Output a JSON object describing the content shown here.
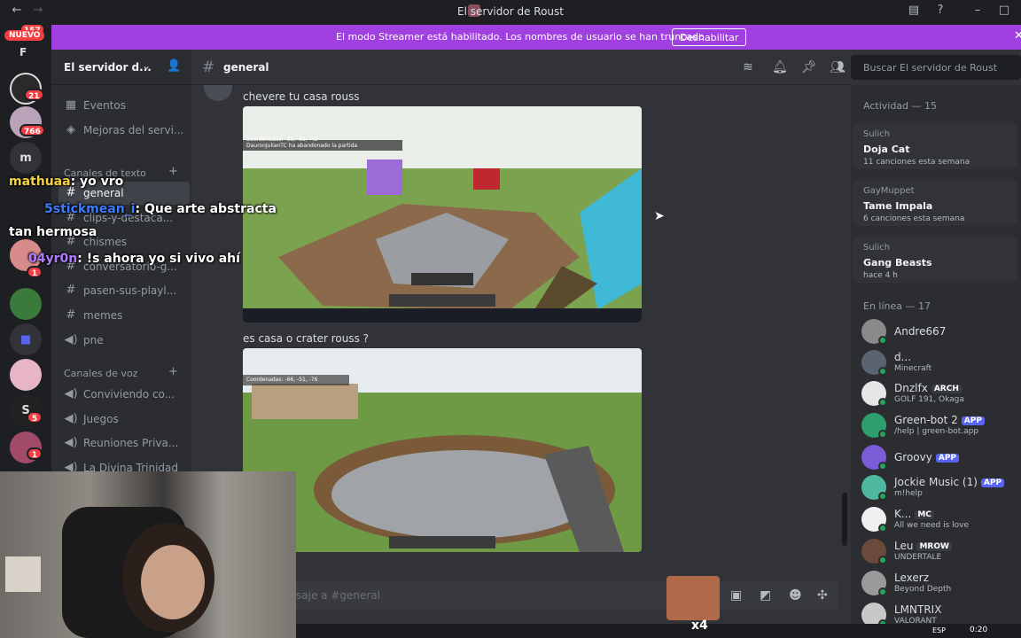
{
  "window": {
    "title": "El servidor de Roust"
  },
  "banner": {
    "message": "El modo Streamer está habilitado. Los nombres de usuario se han truncado.",
    "button": "Deshabilitar"
  },
  "rail": {
    "top_badge": "157",
    "nuevo": "NUEVO",
    "letter_f": "F",
    "badge_21": "21",
    "badge_766": "766",
    "letter_m": "m",
    "badge_1a": "1",
    "badge_1b": "1",
    "badge_5": "5",
    "letter_s": "S"
  },
  "sidebar": {
    "server_name": "El servidor d...",
    "items": [
      {
        "label": "Eventos"
      },
      {
        "label": "Mejoras del servi..."
      }
    ],
    "text_category": "Canales de texto",
    "text_channels": [
      {
        "label": "general"
      },
      {
        "label": "clips-y-destaca..."
      },
      {
        "label": "chismes"
      },
      {
        "label": "conversatorio-g..."
      },
      {
        "label": "pasen-sus-playl..."
      },
      {
        "label": "memes"
      },
      {
        "label": "pne"
      }
    ],
    "voice_category": "Canales de voz",
    "voice_channels": [
      {
        "label": "Conviviendo co..."
      },
      {
        "label": "Juegos"
      },
      {
        "label": "Reuniones Priva..."
      },
      {
        "label": "La Divina Trinidad"
      }
    ]
  },
  "chat_header": {
    "channel": "general",
    "search_placeholder": "Buscar El servidor de Roust"
  },
  "messages": [
    {
      "text": "chevere tu casa rouss",
      "image_hud": "Coordenadas: -86, -55, -42",
      "image_hud2": "DauronJulianTC ha abandonado la partida"
    },
    {
      "text": "es casa o crater rouss ?",
      "image_hud": "Coordenadas: -66, -51, -76"
    }
  ],
  "input": {
    "placeholder": "saje a #general"
  },
  "members": {
    "activity_header": "Actividad — 15",
    "activities": [
      {
        "user": "Sulich",
        "title": "Doja Cat",
        "sub": "11 canciones esta semana"
      },
      {
        "user": "GayMuppet",
        "title": "Tame Impala",
        "sub": "6 canciones esta semana"
      },
      {
        "user": "Sulich",
        "title": "Gang Beasts",
        "sub": "hace 4 h"
      }
    ],
    "online_header": "En línea — 17",
    "online": [
      {
        "name": "Andre667",
        "sub": "",
        "tag": ""
      },
      {
        "name": "d...",
        "sub": "Minecraft",
        "tag": ""
      },
      {
        "name": "Dnzlfx",
        "sub": "GOLF 191, Okaga",
        "tag": "ARCH"
      },
      {
        "name": "Green-bot 2",
        "sub": "/help | green-bot.app",
        "tag": "APP"
      },
      {
        "name": "Groovy",
        "sub": "",
        "tag": "APP"
      },
      {
        "name": "Jockie Music (1)",
        "sub": "m!help",
        "tag": "APP"
      },
      {
        "name": "K...",
        "sub": "All we need is love",
        "tag": "MC"
      },
      {
        "name": "Leu",
        "sub": "UNDERTALE",
        "tag": "MROW"
      },
      {
        "name": "Lexerz",
        "sub": "Beyond Depth",
        "tag": ""
      },
      {
        "name": "LMNTRIX",
        "sub": "VALORANT",
        "tag": ""
      }
    ]
  },
  "overlay_chat": [
    {
      "user": "mathuaa",
      "text": ": yo vro"
    },
    {
      "user": "5stickmean_i",
      "text": ": Que arte abstracta"
    },
    {
      "user": "",
      "text": "tan hermosa"
    },
    {
      "user": "04yr0n",
      "text": ": !s ahora yo si vivo ahí"
    }
  ],
  "taskbar": {
    "lang": "ESP",
    "time": "0:20",
    "x4": "x4"
  },
  "colors": {
    "banner": "#a040e0",
    "accent": "#5865f2",
    "online": "#23a55a",
    "badge": "#f23f43"
  }
}
